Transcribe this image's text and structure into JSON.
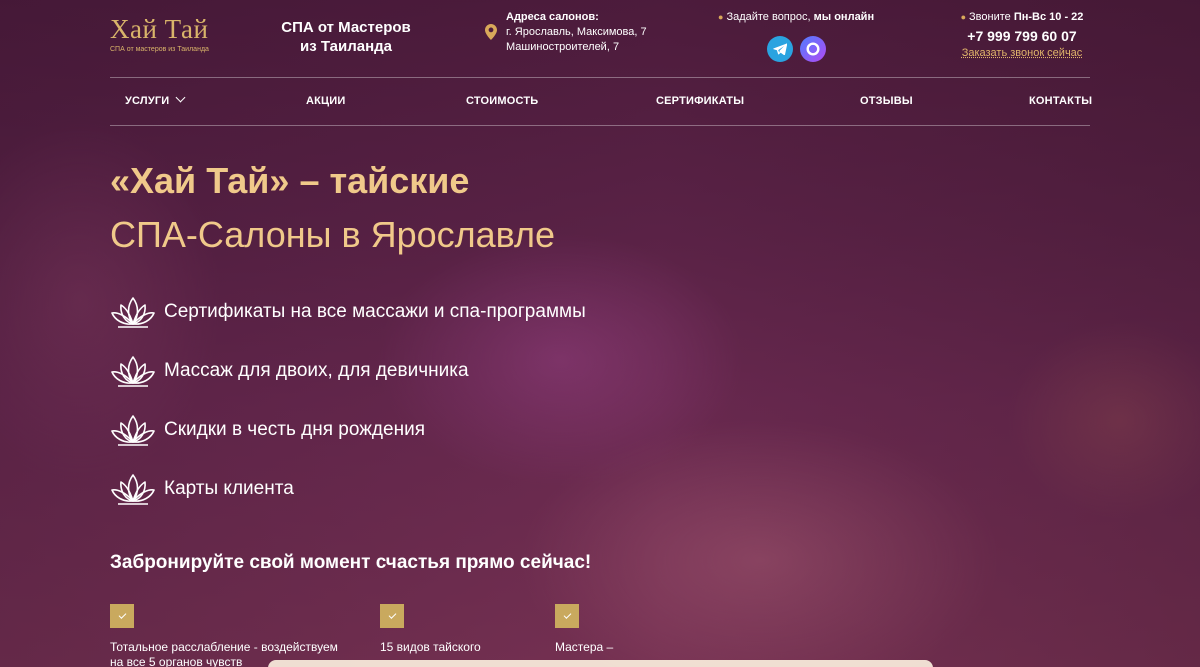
{
  "header": {
    "logo_title": "Хай Тай",
    "logo_subtitle": "СПА от мастеров из Таиланда",
    "slogan_line1": "СПА от Мастеров",
    "slogan_line2": "из Таиланда",
    "addresses_title": "Адреса салонов:",
    "address_1": "г. Ярославль, Максимова, 7",
    "address_2": "Машиностроителей, 7",
    "ask_prefix": "Задайте вопрос,",
    "ask_online": "мы онлайн",
    "messengers": [
      {
        "name": "Telegram",
        "icon": "telegram-icon",
        "color": "#2aa3e0"
      },
      {
        "name": "Max",
        "icon": "max-messenger-icon",
        "color": "#6a5cff"
      }
    ],
    "call_prefix": "Звоните",
    "call_hours": "Пн-Вс 10 - 22",
    "phone": "+7 999 799 60 07",
    "order_call": "Заказать звонок сейчас"
  },
  "nav": {
    "items": [
      {
        "label": "УСЛУГИ",
        "has_dropdown": true
      },
      {
        "label": "АКЦИИ"
      },
      {
        "label": "СТОИМОСТЬ"
      },
      {
        "label": "СЕРТИФИКАТЫ"
      },
      {
        "label": "ОТЗЫВЫ"
      },
      {
        "label": "КОНТАКТЫ"
      }
    ]
  },
  "hero": {
    "title_line1": "«Хай Тай» – тайские",
    "title_line2": "СПА-Салоны в Ярославле",
    "features": [
      {
        "icon": "lotus-icon",
        "label": "Сертификаты на все массажи и спа-программы"
      },
      {
        "icon": "lotus-icon",
        "label": "Массаж для двоих, для девичника"
      },
      {
        "icon": "lotus-icon",
        "label": "Скидки в честь дня рождения"
      },
      {
        "icon": "lotus-icon",
        "label": "Карты клиента"
      }
    ],
    "booking_title": "Забронируйте свой момент счастья прямо сейчас!",
    "perks": [
      {
        "line1": "Тотальное расслабление - воздействуем",
        "line2": "на все 5 органов чувств"
      },
      {
        "line1": "15 видов тайского",
        "line2": ""
      },
      {
        "line1": "Мастера –",
        "line2": ""
      }
    ]
  },
  "colors": {
    "accent_gold": "#d9b46a",
    "title_gold": "#f0c98a",
    "checkbox_gold": "#c9a95e",
    "background_plum": "#5a2346"
  }
}
